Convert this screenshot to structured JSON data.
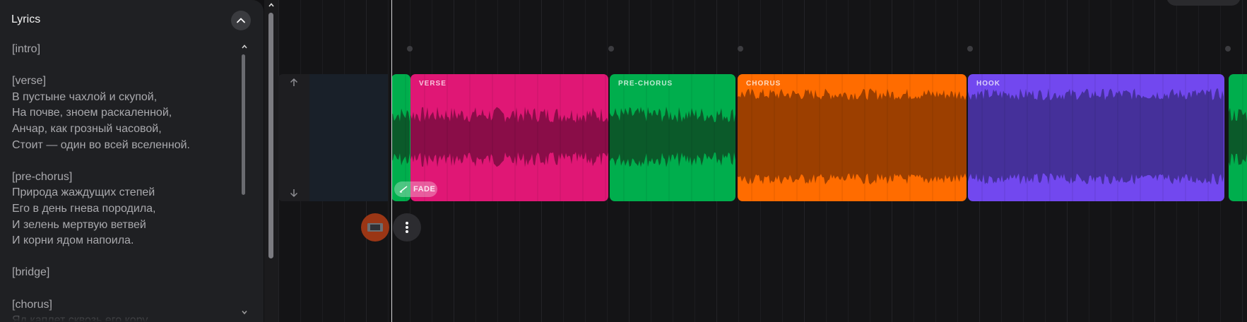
{
  "lyrics_panel": {
    "title": "Lyrics",
    "text": "[intro]\n\n[verse]\nВ пустыне чахлой и скупой,\nНа почве, зноем раскаленной,\nАнчар, как грозный часовой,\nСтоит — один во всей вселенной.\n\n[pre-chorus]\nПрирода жаждущих степей\nЕго в день гнева породила,\nИ зелень мертвую ветвей\nИ корни ядом напоила.\n\n[bridge]\n\n[chorus]\nЯд каплет сквозь его кору"
  },
  "clips": [
    {
      "id": "intro",
      "label": ""
    },
    {
      "id": "verse",
      "label": "VERSE"
    },
    {
      "id": "pre-chorus",
      "label": "PRE-CHORUS"
    },
    {
      "id": "chorus",
      "label": "CHORUS"
    },
    {
      "id": "hook",
      "label": "HOOK"
    },
    {
      "id": "next",
      "label": ""
    }
  ],
  "fade_badge": {
    "label": "FADE"
  },
  "icons": {
    "collapse": "chevron-up-icon",
    "track_up": "arrow-up-icon",
    "track_down": "arrow-down-icon",
    "fade": "fade-curve-icon",
    "cover": "cover-art-icon",
    "more": "more-vertical-icon"
  },
  "colors": {
    "intro": "#00ae4d",
    "verse": "#e01775",
    "pre_chorus": "#00ae4d",
    "chorus": "#ff6c00",
    "hook": "#7248ef",
    "panel": "#1f2023",
    "timeline": "#141416"
  }
}
